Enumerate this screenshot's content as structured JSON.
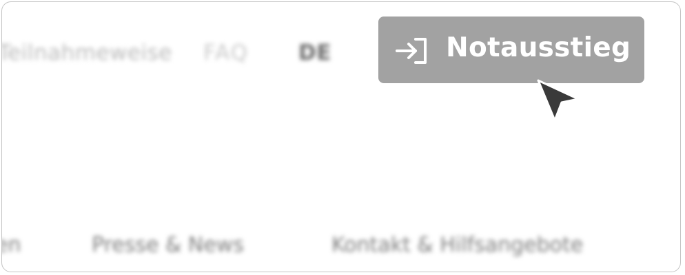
{
  "top_nav": {
    "item_1": "Teilnahmeweise",
    "item_2": "FAQ",
    "language": "DE"
  },
  "emergency_exit": {
    "label": "Notausstieg",
    "icon": "exit-arrow-icon"
  },
  "bottom_nav": {
    "item_1": "en",
    "item_2": "Presse & News",
    "item_3": "Kontakt & Hilfsangebote"
  },
  "colors": {
    "button_bg": "#a2a2a2",
    "button_text": "#ffffff",
    "cursor": "#3a3a3a"
  }
}
